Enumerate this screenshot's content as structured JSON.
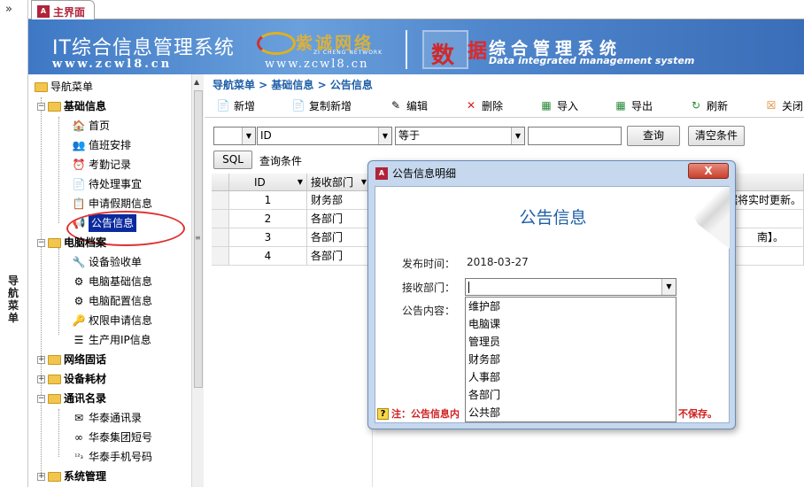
{
  "nav_strip": {
    "chevron": "»",
    "label": "导航菜单"
  },
  "tab": {
    "icon": "A",
    "label": "主界面"
  },
  "banner": {
    "title": "IT综合信息管理系统",
    "url1": "www.zcwl8.cn",
    "company": "紫诚网络",
    "company_sub": "ZI CHENG NETWORK",
    "url2": "www.zcwl8.cn",
    "shu": "数",
    "ju": "据",
    "mgmt": "综合管理系统",
    "en": "Data integrated management system"
  },
  "sidebar": {
    "root": "导航菜单",
    "groups": [
      {
        "label": "基础信息",
        "expanded": true,
        "items": [
          "首页",
          "值班安排",
          "考勤记录",
          "待处理事宜",
          "申请假期信息",
          "公告信息"
        ]
      },
      {
        "label": "电脑档案",
        "expanded": true,
        "items": [
          "设备验收单",
          "电脑基础信息",
          "电脑配置信息",
          "权限申请信息",
          "生产用IP信息"
        ]
      },
      {
        "label": "网络固话",
        "expanded": false
      },
      {
        "label": "设备耗材",
        "expanded": false
      },
      {
        "label": "通讯名录",
        "expanded": true,
        "items": [
          "华泰通讯录",
          "华泰集团短号",
          "华泰手机号码"
        ]
      },
      {
        "label": "系统管理",
        "expanded": false
      }
    ],
    "selected": "公告信息"
  },
  "breadcrumb": "导航菜单 > 基础信息 > 公告信息",
  "toolbar": {
    "new": "新增",
    "copy_new": "复制新增",
    "edit": "编辑",
    "delete": "删除",
    "import": "导入",
    "export": "导出",
    "refresh": "刷新",
    "close": "关闭"
  },
  "filter": {
    "field": "ID",
    "operator": "等于",
    "value": "",
    "query": "查询",
    "clear": "清空条件"
  },
  "sql": {
    "button": "SQL",
    "label": "查询条件"
  },
  "grid": {
    "columns": [
      "ID",
      "接收部门"
    ],
    "rows": [
      {
        "id": "1",
        "dept": "财务部",
        "tail": "据将实时更新。"
      },
      {
        "id": "2",
        "dept": "各部门",
        "tail": ""
      },
      {
        "id": "3",
        "dept": "各部门",
        "tail": "南】。"
      },
      {
        "id": "4",
        "dept": "各部门",
        "tail": ""
      }
    ]
  },
  "dialog": {
    "title": "公告信息明细",
    "close": "X",
    "heading": "公告信息",
    "date_label": "发布时间：",
    "date_value": "2018-03-27",
    "dept_label": "接收部门：",
    "dept_value": "",
    "content_label": "公告内容：",
    "options": [
      "维护部",
      "电脑课",
      "管理员",
      "财务部",
      "人事部",
      "各部门",
      "公共部"
    ],
    "note_left": "注：公告信息内",
    "note_right": "不保存。"
  },
  "colors": {
    "accent": "#1f5fa8",
    "selection": "#0b2a9e",
    "warning": "#d02020",
    "highlight_circle": "#e03030"
  }
}
